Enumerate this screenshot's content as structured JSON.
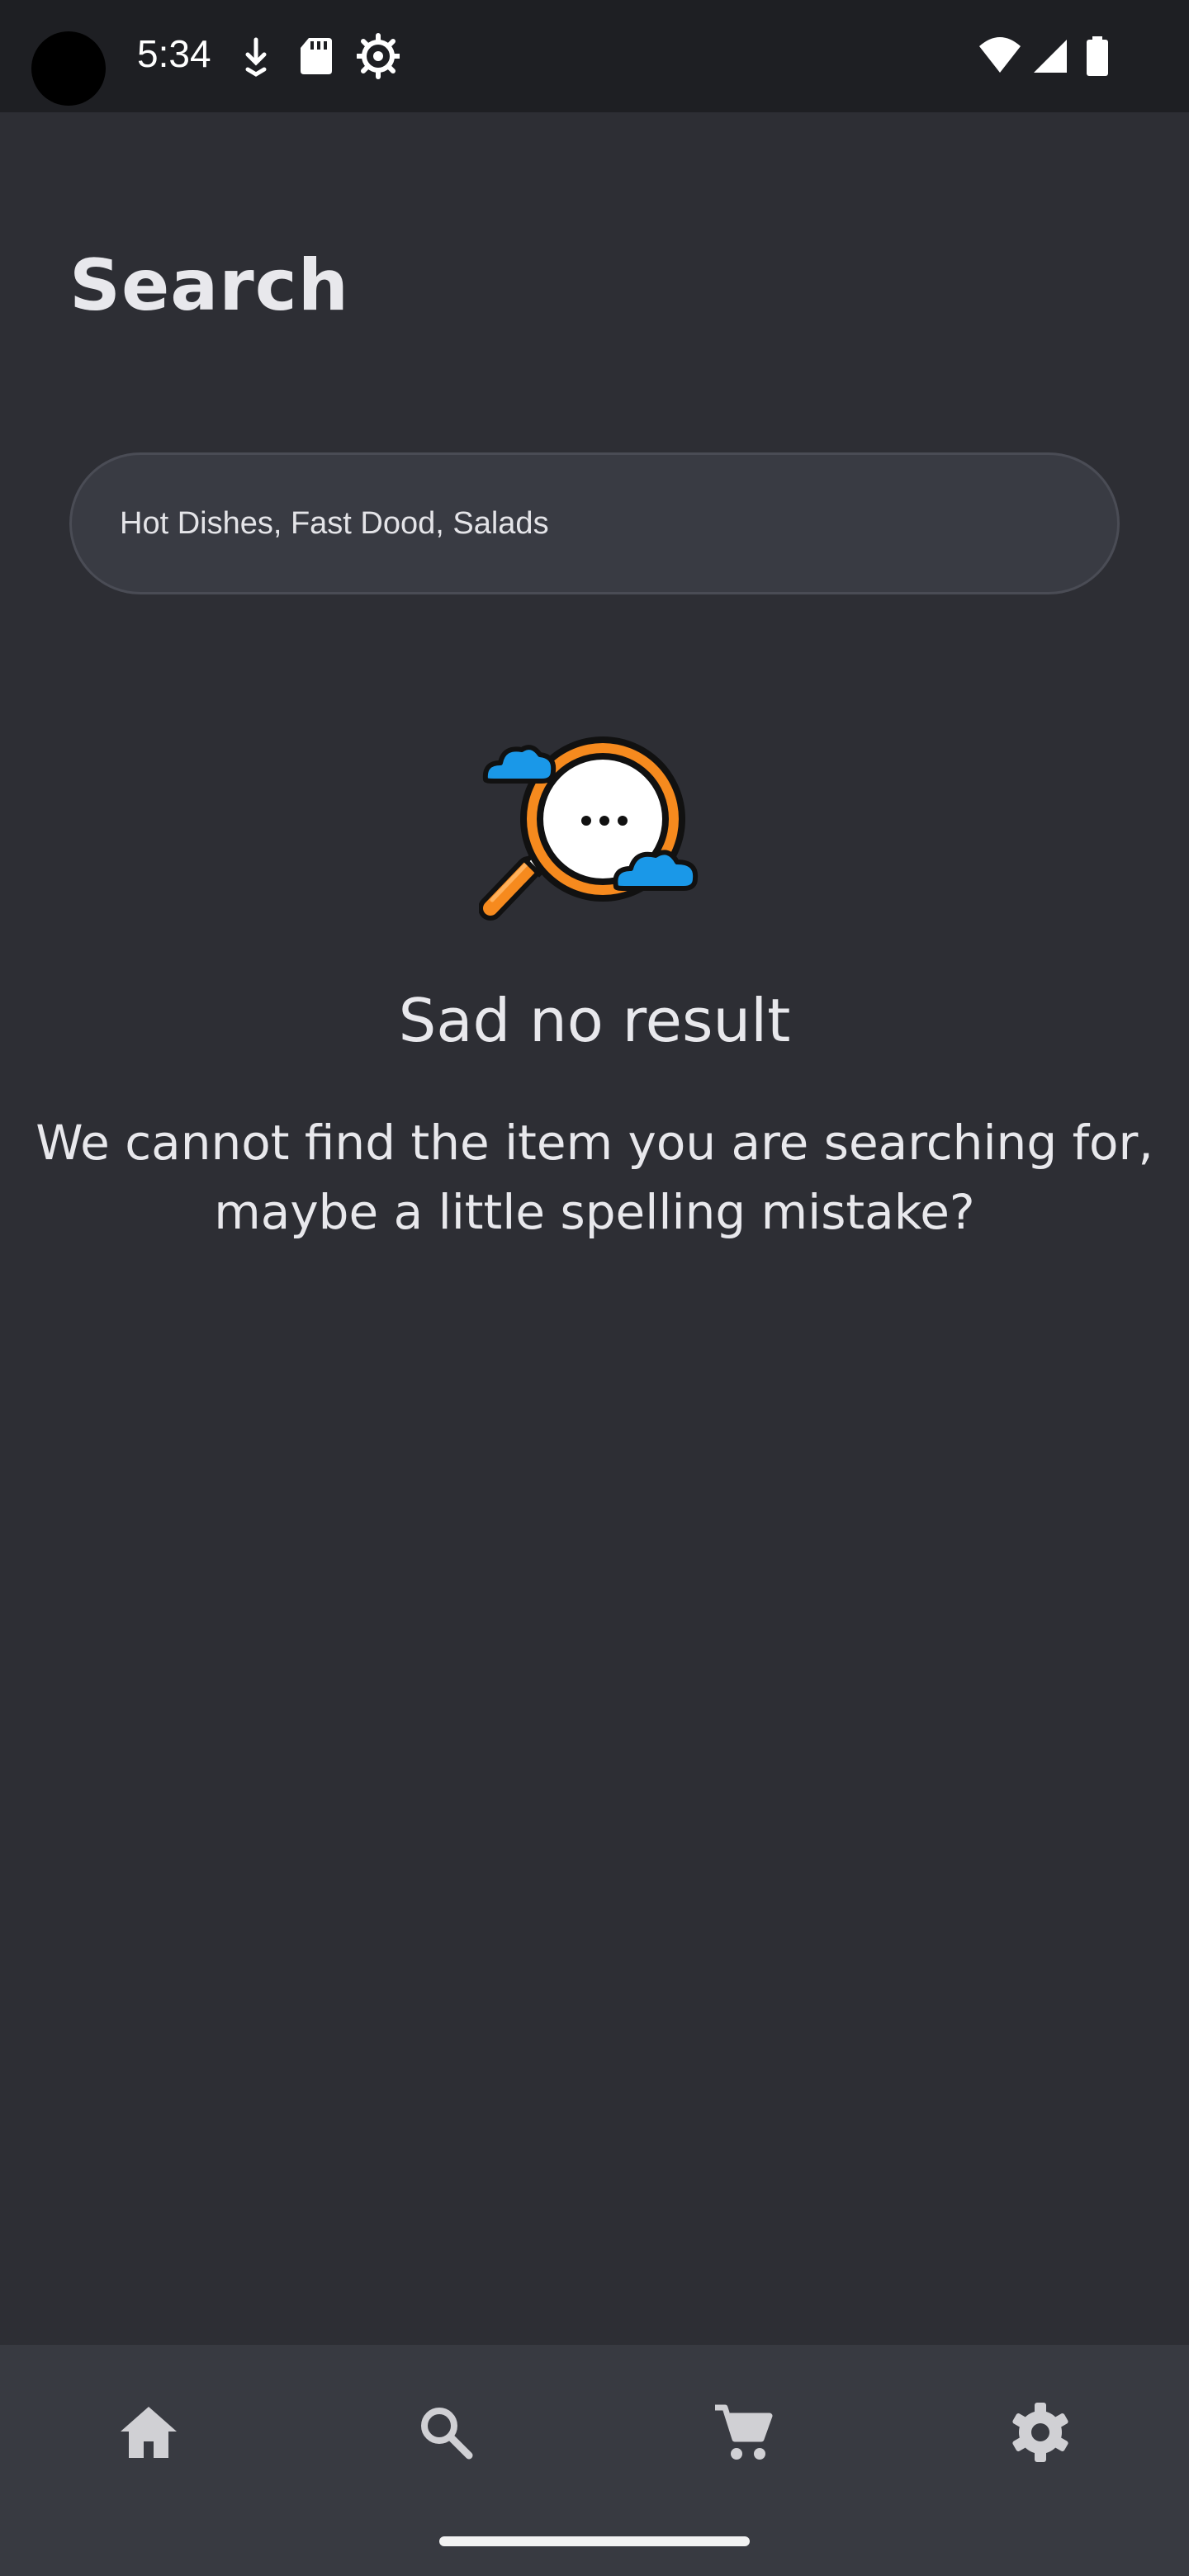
{
  "status_bar": {
    "time": "5:34",
    "left_icons": [
      "download-arrow-icon",
      "sd-card-icon",
      "settings-gear-icon"
    ],
    "right_icons": [
      "wifi-icon",
      "cell-signal-icon",
      "battery-icon"
    ]
  },
  "header": {
    "title": "Search"
  },
  "search": {
    "placeholder": "Hot Dishes, Fast Dood, Salads",
    "value": ""
  },
  "empty_state": {
    "illustration": "magnifier-with-clouds-illustration",
    "title": "Sad no result",
    "message": "We cannot find the item you are searching for, maybe a little spelling mistake?"
  },
  "bottom_nav": {
    "items": [
      {
        "icon": "home-icon",
        "selected": false
      },
      {
        "icon": "search-icon",
        "selected": true
      },
      {
        "icon": "cart-icon",
        "selected": false
      },
      {
        "icon": "settings-icon",
        "selected": false
      }
    ]
  },
  "colors": {
    "background": "#2d2e34",
    "status_bar": "#1e1f23",
    "search_field": "#393b43",
    "bottom_nav": "#383a41",
    "accent_orange": "#f68a1e",
    "accent_blue": "#1a98e8",
    "nav_icon": "#d0d0d4"
  }
}
